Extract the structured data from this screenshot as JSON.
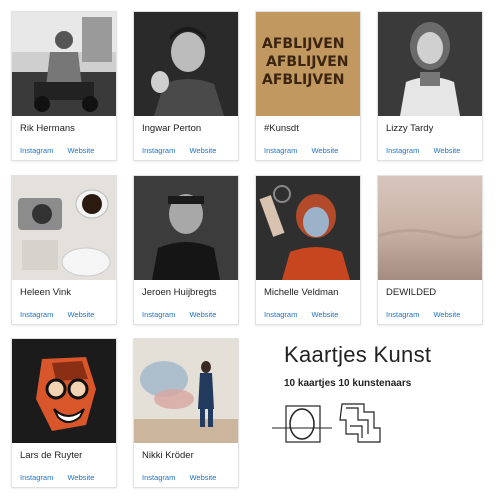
{
  "artists": [
    {
      "name": "Rik Hermans",
      "instagram": "Instagram",
      "website": "Website"
    },
    {
      "name": "Ingwar Perton",
      "instagram": "Instagram",
      "website": "Website"
    },
    {
      "name": "#Kunsdt",
      "instagram": "Instagram",
      "website": "Website"
    },
    {
      "name": "Lizzy Tardy",
      "instagram": "Instagram",
      "website": "Website"
    },
    {
      "name": "Heleen Vink",
      "instagram": "Instagram",
      "website": "Website"
    },
    {
      "name": "Jeroen Huijbregts",
      "instagram": "Instagram",
      "website": "Website"
    },
    {
      "name": "Michelle Veldman",
      "instagram": "Instagram",
      "website": "Website"
    },
    {
      "name": "DEWILDED",
      "instagram": "Instagram",
      "website": "Website"
    },
    {
      "name": "Lars de Ruyter",
      "instagram": "Instagram",
      "website": "Website"
    },
    {
      "name": "Nikki Kröder",
      "instagram": "Instagram",
      "website": "Website"
    }
  ],
  "kunsdt_artwork_text": "AFBLIJVEN",
  "promo": {
    "title": "Kaartjes Kunst",
    "subtitle": "10 kaartjes 10 kunstenaars"
  },
  "colors": {
    "link": "#1e73c8",
    "text": "#222222",
    "card_border": "#e2e2e2"
  }
}
